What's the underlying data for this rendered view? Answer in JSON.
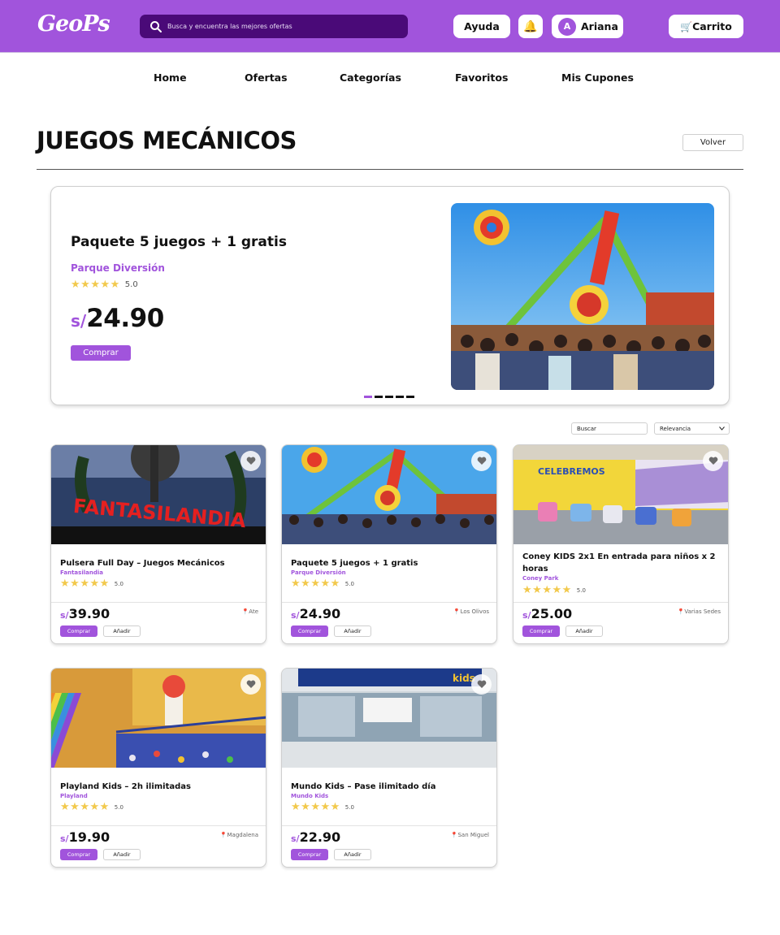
{
  "header": {
    "logo": "GeoPs",
    "search_placeholder": "Busca y encuentra las mejores ofertas",
    "help_label": "Ayuda",
    "user_initial": "A",
    "user_name": "Ariana",
    "cart_label": "Carrito",
    "cart_icon": "🛒",
    "bell_icon": "🔔"
  },
  "nav": [
    "Home",
    "Ofertas",
    "Categorías",
    "Favoritos",
    "Mis Cupones"
  ],
  "page": {
    "title": "JUEGOS MECÁNICOS",
    "back_label": "Volver"
  },
  "hero": {
    "title": "Paquete 5 juegos + 1 gratis",
    "vendor": "Parque Diversión",
    "rating": "5.0",
    "currency": "s/",
    "price": "24.90",
    "buy_label": "Comprar",
    "slides_total": 5,
    "active_slide": 1
  },
  "filters": {
    "search_placeholder": "Buscar",
    "sort_value": "Relevancia"
  },
  "products": [
    {
      "title": "Pulsera Full Day – Juegos Mecánicos",
      "vendor": "Fantasilandia",
      "rating": "5.0",
      "currency": "s/",
      "price": "39.90",
      "location": "Ate",
      "buy_label": "Comprar",
      "add_label": "Añadir",
      "image_sign": "FANTASILANDIA"
    },
    {
      "title": "Paquete 5 juegos + 1 gratis",
      "vendor": "Parque Diversión",
      "rating": "5.0",
      "currency": "s/",
      "price": "24.90",
      "location": "Los Olivos",
      "buy_label": "Comprar",
      "add_label": "Añadir"
    },
    {
      "title": "Coney KIDS 2x1 En entrada para niños x 2 horas",
      "vendor": "Coney Park",
      "rating": "5.0",
      "currency": "s/",
      "price": "25.00",
      "location": "Varias Sedes",
      "buy_label": "Comprar",
      "add_label": "Añadir",
      "image_sign": "CELEBREMOS"
    },
    {
      "title": "Playland Kids – 2h ilimitadas",
      "vendor": "Playland",
      "rating": "5.0",
      "currency": "s/",
      "price": "19.90",
      "location": "Magdalena",
      "buy_label": "Comprar",
      "add_label": "Añadir"
    },
    {
      "title": "Mundo Kids – Pase ilimitado día",
      "vendor": "Mundo Kids",
      "rating": "5.0",
      "currency": "s/",
      "price": "22.90",
      "location": "San Miguel",
      "buy_label": "Comprar",
      "add_label": "Añadir",
      "image_sign": "kids"
    }
  ],
  "colors": {
    "brand": "#a154dc",
    "search_bg": "#4a0a78",
    "star": "#f2c94c"
  },
  "icons": {
    "location": "📍",
    "star": "★",
    "favorite": "heart-icon"
  }
}
